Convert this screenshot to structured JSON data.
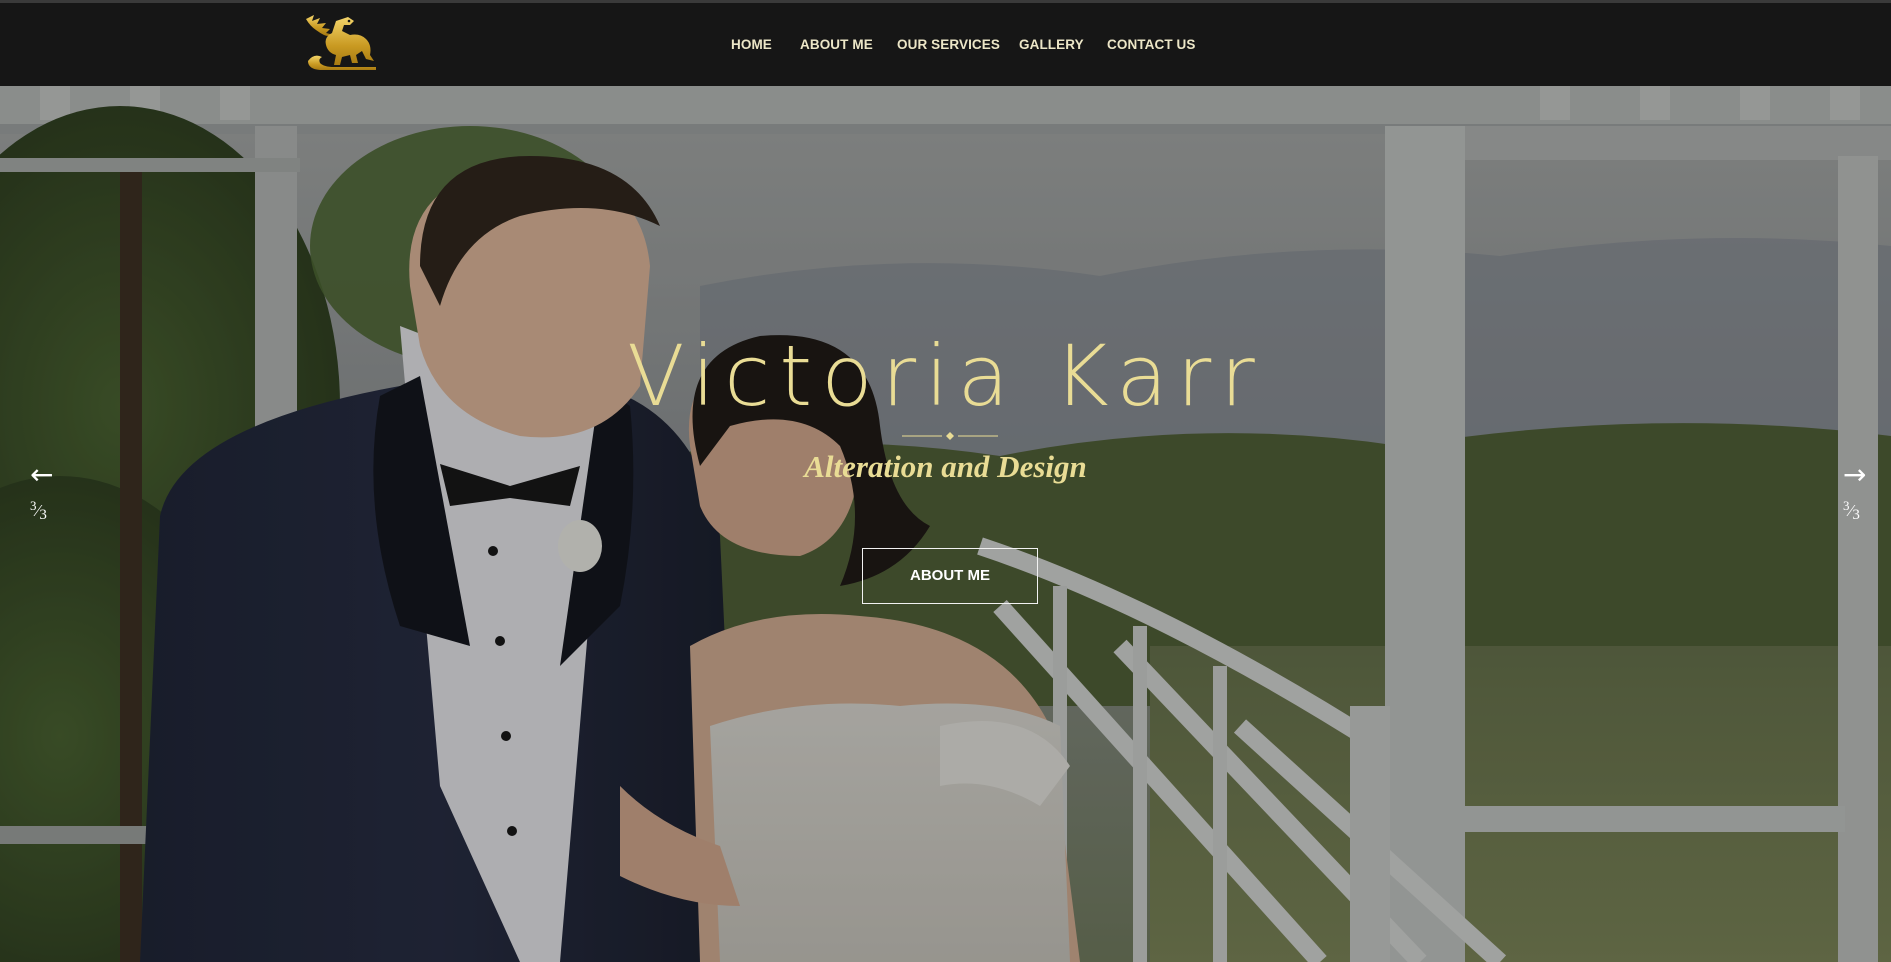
{
  "nav": {
    "items": [
      {
        "label": "HOME"
      },
      {
        "label": "ABOUT ME"
      },
      {
        "label": "OUR SERVICES"
      },
      {
        "label": "GALLERY"
      },
      {
        "label": "CONTACT US"
      }
    ],
    "logo_icon": "griffin-logo-icon"
  },
  "hero": {
    "title": "Victoria Karr",
    "subtitle": "Alteration and Design",
    "button_label": "ABOUT ME",
    "prev_arrow": "←",
    "next_arrow": "→",
    "slide_current": "3",
    "slide_sep": "⁄",
    "slide_total": "3",
    "background": "wedding-couple-photo"
  },
  "colors": {
    "accent_gold": "#e9dc95",
    "nav_background": "#161616",
    "nav_text": "#ece6c7",
    "button_border": "#f2f2f2"
  }
}
